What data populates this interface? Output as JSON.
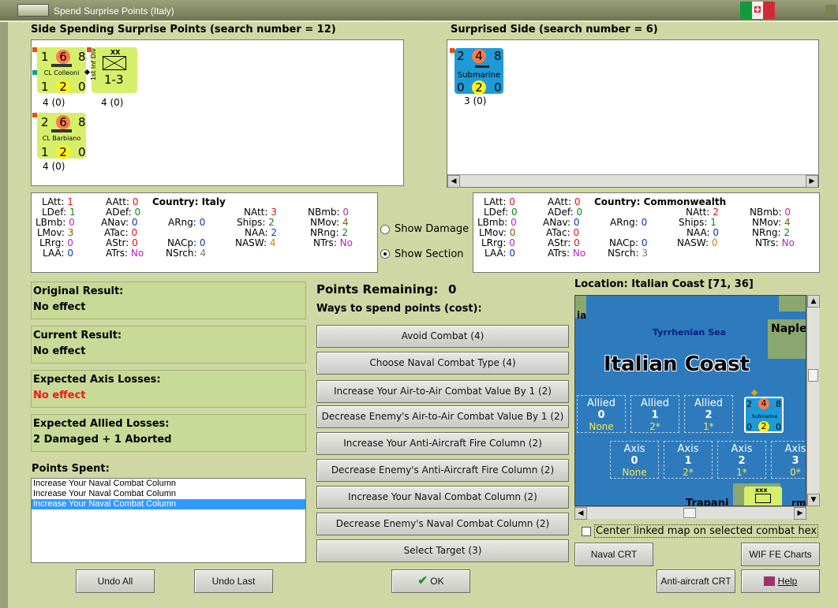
{
  "window": {
    "title": "Spend Surprise Points (Italy)"
  },
  "spending_side": {
    "header": "Side Spending Surprise Points (search number = 12)",
    "units": [
      {
        "name": "CL Colleoni",
        "top_left": "1",
        "top_mid": "6",
        "top_right": "8",
        "bot_left": "1",
        "bot_mid": "2",
        "bot_right": "0",
        "status": "4 (0)"
      },
      {
        "name": "1st Inf Div",
        "size": "XX",
        "value": "1-3",
        "status": "4 (0)"
      },
      {
        "name": "CL Barbiano",
        "top_left": "2",
        "top_mid": "6",
        "top_right": "8",
        "bot_left": "1",
        "bot_mid": "2",
        "bot_right": "0",
        "status": "4 (0)"
      }
    ]
  },
  "surprised_side": {
    "header": "Surprised Side (search number = 6)",
    "units": [
      {
        "name": "Submarine",
        "top_left": "2",
        "top_mid": "4",
        "top_right": "8",
        "bot_left": "0",
        "bot_mid": "2",
        "bot_right": "0",
        "status": "3 (0)"
      }
    ]
  },
  "left_stats": {
    "country_label": "Country: Italy",
    "items": [
      {
        "k": "LAtt:",
        "v": "1"
      },
      {
        "k": "LDef:",
        "v": "1"
      },
      {
        "k": "LBmb:",
        "v": "0"
      },
      {
        "k": "LMov:",
        "v": "3"
      },
      {
        "k": "LRrg:",
        "v": "0"
      },
      {
        "k": "LAA:",
        "v": "0"
      },
      {
        "k": "AAtt:",
        "v": "0"
      },
      {
        "k": "ADef:",
        "v": "0"
      },
      {
        "k": "ANav:",
        "v": "0"
      },
      {
        "k": "ATac:",
        "v": "0"
      },
      {
        "k": "AStr:",
        "v": "0"
      },
      {
        "k": "ATrs:",
        "v": "No"
      },
      {
        "k": "ARng:",
        "v": "0"
      },
      {
        "k": "NACp:",
        "v": "0"
      },
      {
        "k": "NSrch:",
        "v": "4"
      },
      {
        "k": "NAtt:",
        "v": "3"
      },
      {
        "k": "Ships:",
        "v": "2"
      },
      {
        "k": "NAA:",
        "v": "2"
      },
      {
        "k": "NASW:",
        "v": "4"
      },
      {
        "k": "NBmb:",
        "v": "0"
      },
      {
        "k": "NMov:",
        "v": "4"
      },
      {
        "k": "NRng:",
        "v": "2"
      },
      {
        "k": "NTrs:",
        "v": "No"
      }
    ]
  },
  "right_stats": {
    "country_label": "Country: Commonwealth",
    "items": [
      {
        "k": "LAtt:",
        "v": "0"
      },
      {
        "k": "LDef:",
        "v": "0"
      },
      {
        "k": "LBmb:",
        "v": "0"
      },
      {
        "k": "LMov:",
        "v": "0"
      },
      {
        "k": "LRrg:",
        "v": "0"
      },
      {
        "k": "LAA:",
        "v": "0"
      },
      {
        "k": "AAtt:",
        "v": "0"
      },
      {
        "k": "ADef:",
        "v": "0"
      },
      {
        "k": "ANav:",
        "v": "0"
      },
      {
        "k": "ATac:",
        "v": "0"
      },
      {
        "k": "AStr:",
        "v": "0"
      },
      {
        "k": "ATrs:",
        "v": "No"
      },
      {
        "k": "ARng:",
        "v": "0"
      },
      {
        "k": "NACp:",
        "v": "0"
      },
      {
        "k": "NSrch:",
        "v": "3"
      },
      {
        "k": "NAtt:",
        "v": "2"
      },
      {
        "k": "Ships:",
        "v": "1"
      },
      {
        "k": "NAA:",
        "v": "0"
      },
      {
        "k": "NASW:",
        "v": "0"
      },
      {
        "k": "NBmb:",
        "v": "0"
      },
      {
        "k": "NMov:",
        "v": "4"
      },
      {
        "k": "NRng:",
        "v": "2"
      },
      {
        "k": "NTrs:",
        "v": "No"
      }
    ]
  },
  "options": {
    "show_damage": "Show Damage",
    "show_section": "Show Section",
    "selected": "show_section"
  },
  "results": {
    "original": {
      "label": "Original Result:",
      "value": "No effect"
    },
    "current": {
      "label": "Current Result:",
      "value": "No effect"
    },
    "axis_losses": {
      "label": "Expected Axis Losses:",
      "value": "No effect"
    },
    "allied_losses": {
      "label": "Expected Allied Losses:",
      "value": "2 Damaged + 1 Aborted"
    }
  },
  "points_spent": {
    "label": "Points Spent:",
    "items": [
      "Increase Your Naval Combat Column",
      "Increase Your Naval Combat Column",
      "Increase Your Naval Combat Column"
    ],
    "selected_index": 2
  },
  "points": {
    "remaining_label": "Points Remaining:",
    "remaining_value": "0",
    "ways_label": "Ways to spend points (cost):"
  },
  "spend_options": [
    "Avoid Combat (4)",
    "Choose Naval Combat Type (4)",
    "Increase Your Air-to-Air Combat Value By 1 (2)",
    "Decrease Enemy's Air-to-Air Combat Value By 1 (2)",
    "Increase Your Anti-Aircraft Fire Column (2)",
    "Decrease Enemy's Anti-Aircraft Fire Column (2)",
    "Increase Your Naval Combat Column (2)",
    "Decrease Enemy's Naval Combat Column (2)",
    "Select Target (3)"
  ],
  "location": {
    "label": "Location: Italian Coast [71, 36]",
    "map_title": "Italian Coast",
    "sea_label": "Tyrrhenian Sea",
    "naples_label": "Naple",
    "ia_label": "ia",
    "trapani_label": "Trapani",
    "rm_label": "rm",
    "corps_label": "xxx",
    "allied_boxes": [
      {
        "t": "Allied",
        "n": "0",
        "s": "None"
      },
      {
        "t": "Allied",
        "n": "1",
        "s": "2*"
      },
      {
        "t": "Allied",
        "n": "2",
        "s": "1*"
      }
    ],
    "axis_boxes": [
      {
        "t": "Axis",
        "n": "0",
        "s": "None"
      },
      {
        "t": "Axis",
        "n": "1",
        "s": "2*"
      },
      {
        "t": "Axis",
        "n": "2",
        "s": "1*"
      },
      {
        "t": "Axis",
        "n": "3",
        "s": "0*"
      }
    ],
    "map_counter": {
      "name": "Submarine",
      "top_left": "2",
      "top_mid": "4",
      "top_right": "8",
      "bot_left": "0",
      "bot_mid": "2",
      "bot_right": "0"
    },
    "center_label": "Center linked map on selected combat hex"
  },
  "buttons": {
    "undo_all": "Undo All",
    "undo_last": "Undo Last",
    "ok": "OK",
    "naval_crt": "Naval CRT",
    "wif_charts": "WIF FE Charts",
    "aa_crt": "Anti-aircraft CRT",
    "help": "Help"
  },
  "colors": {
    "background": "#cfd8a4",
    "italy_counter": "#d6ef6a",
    "cw_counter": "#1e9ad7",
    "map_sea": "#2d7bbd"
  }
}
